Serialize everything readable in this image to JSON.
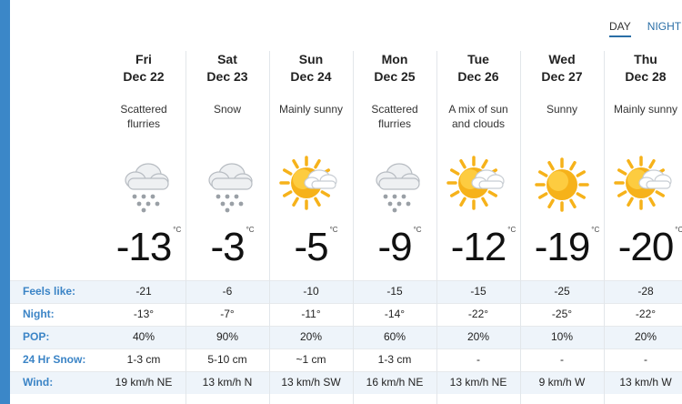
{
  "nav": {
    "day_label": "DAY",
    "night_label": "NIGHT"
  },
  "days": [
    {
      "name": "Fri",
      "date": "Dec 22",
      "condition": "Scattered\nflurries",
      "icon": "cloud-snow-icon",
      "temp": "-13",
      "unit": "°C"
    },
    {
      "name": "Sat",
      "date": "Dec 23",
      "condition": "Snow",
      "icon": "cloud-snow-icon",
      "temp": "-3",
      "unit": "°C"
    },
    {
      "name": "Sun",
      "date": "Dec 24",
      "condition": "Mainly sunny",
      "icon": "sun-cloud-icon",
      "temp": "-5",
      "unit": "°C"
    },
    {
      "name": "Mon",
      "date": "Dec 25",
      "condition": "Scattered\nflurries",
      "icon": "cloud-snow-icon",
      "temp": "-9",
      "unit": "°C"
    },
    {
      "name": "Tue",
      "date": "Dec 26",
      "condition": "A mix of sun\nand clouds",
      "icon": "sun-cloud-icon",
      "temp": "-12",
      "unit": "°C"
    },
    {
      "name": "Wed",
      "date": "Dec 27",
      "condition": "Sunny",
      "icon": "sun-icon",
      "temp": "-19",
      "unit": "°C"
    },
    {
      "name": "Thu",
      "date": "Dec 28",
      "condition": "Mainly sunny",
      "icon": "sun-cloud-icon",
      "temp": "-20",
      "unit": "°C"
    }
  ],
  "rows": [
    {
      "label": "Feels like:",
      "values": [
        "-21",
        "-6",
        "-10",
        "-15",
        "-15",
        "-25",
        "-28"
      ]
    },
    {
      "label": "Night:",
      "values": [
        "-13°",
        "-7°",
        "-11°",
        "-14°",
        "-22°",
        "-25°",
        "-22°"
      ]
    },
    {
      "label": "POP:",
      "values": [
        "40%",
        "90%",
        "20%",
        "60%",
        "20%",
        "10%",
        "20%"
      ]
    },
    {
      "label": "24 Hr Snow:",
      "values": [
        "1-3 cm",
        "5-10 cm",
        "~1 cm",
        "1-3 cm",
        "-",
        "-",
        "-"
      ]
    },
    {
      "label": "Wind:",
      "values": [
        "19 km/h NE",
        "13 km/h N",
        "13 km/h SW",
        "16 km/h NE",
        "13 km/h NE",
        "9 km/h W",
        "13 km/h W"
      ]
    }
  ],
  "colors": {
    "accent": "#3b84c6",
    "left_bar": "#3b87c8",
    "row_shade": "#eef4fa",
    "sun": "#f6b21a"
  }
}
